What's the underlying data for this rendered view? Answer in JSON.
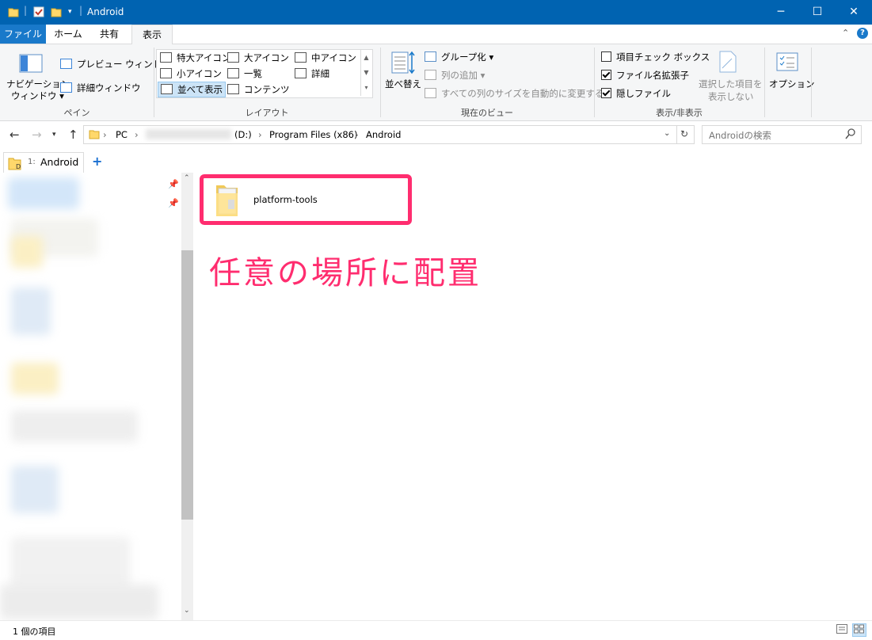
{
  "window": {
    "title": "Android",
    "accent": "#0063b1",
    "buttons": {
      "minimize": "─",
      "maximize": "☐",
      "close": "✕"
    }
  },
  "ribbon_tabs": [
    "ファイル",
    "ホーム",
    "共有",
    "表示"
  ],
  "ribbon": {
    "pane": {
      "nav_pane_line1": "ナビゲーション",
      "nav_pane_line2": "ウィンドウ ▾",
      "preview": "プレビュー ウィンドウ",
      "details": "詳細ウィンドウ",
      "title": "ペイン"
    },
    "layout": {
      "items": [
        "特大アイコン",
        "大アイコン",
        "中アイコン",
        "小アイコン",
        "一覧",
        "詳細",
        "並べて表示",
        "コンテンツ"
      ],
      "title": "レイアウト"
    },
    "current_view": {
      "sort": "並べ替え",
      "group": "グループ化",
      "add_column": "列の追加",
      "autosize": "すべての列のサイズを自動的に変更する",
      "title": "現在のビュー"
    },
    "show_hide": {
      "item_checkbox": "項目チェック ボックス",
      "item_checkbox_checked": false,
      "extensions": "ファイル名拡張子",
      "extensions_checked": true,
      "hidden": "隠しファイル",
      "hidden_checked": true,
      "hide_selected_line1": "選択した項目を",
      "hide_selected_line2": "表示しない",
      "title": "表示/非表示"
    },
    "options": "オプション"
  },
  "address": {
    "crumbs": [
      "PC",
      "(D:)",
      "Program Files (x86)",
      "Android"
    ],
    "search_placeholder": "Androidの検索"
  },
  "folder_tabs": {
    "tab_index": "1:",
    "tab_label": "Android",
    "add": "+"
  },
  "content": {
    "items": [
      {
        "name": "platform-tools"
      }
    ],
    "annotation": "任意の場所に配置",
    "highlight_color": "#ff2d6f"
  },
  "status": {
    "count": "1 個の項目"
  }
}
